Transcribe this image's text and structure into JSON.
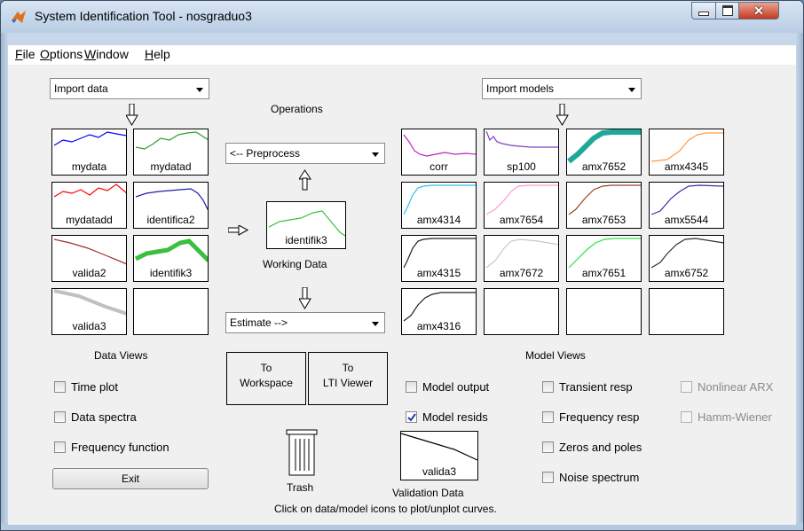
{
  "window": {
    "title": "System Identification Tool - nosgraduo3"
  },
  "menu": [
    {
      "label": "File",
      "mnemonic": "F"
    },
    {
      "label": "Options",
      "mnemonic": "O"
    },
    {
      "label": "Window",
      "mnemonic": "W"
    },
    {
      "label": "Help",
      "mnemonic": "H"
    }
  ],
  "import_data": {
    "selected": "Import data"
  },
  "import_models": {
    "selected": "Import models"
  },
  "operations": {
    "title": "Operations",
    "preprocess": "<-- Preprocess",
    "estimate": "Estimate -->",
    "working_label": "identifik3",
    "working_caption": "Working Data"
  },
  "data_icons": [
    {
      "label": "mydata",
      "color": "#0000ff"
    },
    {
      "label": "mydatad",
      "color": "#2ca02c"
    },
    {
      "label": "mydatadd",
      "color": "#ff0000"
    },
    {
      "label": "identifica2",
      "color": "#1f1fa8"
    },
    {
      "label": "valida2",
      "color": "#a0302a"
    },
    {
      "label": "identifik3",
      "color": "#3cbf3c"
    },
    {
      "label": "valida3",
      "color": "#c0c0c0"
    },
    {
      "label": "",
      "color": ""
    }
  ],
  "model_icons": [
    {
      "label": "corr",
      "color": "#c020c0"
    },
    {
      "label": "sp100",
      "color": "#8040c0"
    },
    {
      "label": "amx7652",
      "color": "#1fa89a"
    },
    {
      "label": "amx4345",
      "color": "#ff9a40"
    },
    {
      "label": "amx4314",
      "color": "#30c0f0"
    },
    {
      "label": "amx7654",
      "color": "#ff9ad0"
    },
    {
      "label": "amx7653",
      "color": "#a04020"
    },
    {
      "label": "amx5544",
      "color": "#3030b0"
    },
    {
      "label": "amx4315",
      "color": "#202020"
    },
    {
      "label": "amx7672",
      "color": "#c8c8c8"
    },
    {
      "label": "amx7651",
      "color": "#30e040"
    },
    {
      "label": "amx6752",
      "color": "#303030"
    },
    {
      "label": "amx4316",
      "color": "#202020"
    },
    {
      "label": "",
      "color": ""
    },
    {
      "label": "",
      "color": ""
    },
    {
      "label": "",
      "color": ""
    }
  ],
  "data_views": {
    "title": "Data Views",
    "checkboxes": [
      {
        "label": "Time plot",
        "checked": false
      },
      {
        "label": "Data spectra",
        "checked": false
      },
      {
        "label": "Frequency function",
        "checked": false
      }
    ],
    "exit_label": "Exit"
  },
  "buttons": {
    "to_workspace": [
      "To",
      "Workspace"
    ],
    "to_lti": [
      "To",
      "LTI Viewer"
    ]
  },
  "trash_label": "Trash",
  "model_views": {
    "title": "Model Views",
    "col1": [
      {
        "label": "Model output",
        "checked": false
      },
      {
        "label": "Model resids",
        "checked": true
      }
    ],
    "col2": [
      {
        "label": "Transient resp",
        "checked": false
      },
      {
        "label": "Frequency resp",
        "checked": false
      },
      {
        "label": "Zeros and poles",
        "checked": false
      },
      {
        "label": "Noise spectrum",
        "checked": false
      }
    ],
    "col3": [
      {
        "label": "Nonlinear ARX",
        "checked": false,
        "disabled": true
      },
      {
        "label": "Hamm-Wiener",
        "checked": false,
        "disabled": true
      }
    ]
  },
  "validation": {
    "label": "valida3",
    "caption": "Validation Data"
  },
  "hint": "Click on data/model icons to plot/unplot curves."
}
